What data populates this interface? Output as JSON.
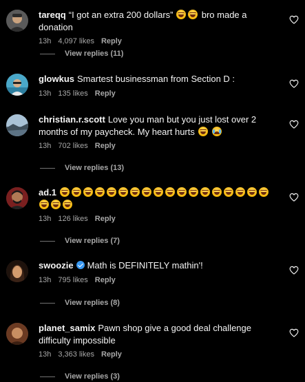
{
  "comments": [
    {
      "username": "tareqq",
      "text": "“I got an extra 200 dollars”",
      "text_after_emoji": "bro made a donation",
      "emojis": [
        "laugh-emoji",
        "laugh-emoji"
      ],
      "time": "13h",
      "likes": "4,097 likes",
      "reply_label": "Reply",
      "view_replies": "View replies (11)",
      "avatar_color": "#6e6e6e"
    },
    {
      "username": "glowkus",
      "text": "Smartest businessman from Section D :",
      "time": "13h",
      "likes": "135 likes",
      "reply_label": "Reply",
      "avatar_color": "#4aa8c9"
    },
    {
      "username": "christian.r.scott",
      "text": "Love you man but you just lost over 2 months of my paycheck. My heart hurts",
      "emojis": [
        "laugh-emoji",
        "crying-laugh-emoji"
      ],
      "time": "13h",
      "likes": "702 likes",
      "reply_label": "Reply",
      "view_replies": "View replies (13)",
      "avatar_color": "#7a8c99"
    },
    {
      "username": "ad.1",
      "emoji_count": 21,
      "time": "13h",
      "likes": "126 likes",
      "reply_label": "Reply",
      "view_replies": "View replies (7)",
      "avatar_color": "#8a2a2a"
    },
    {
      "username": "swoozie",
      "verified": true,
      "text": "Math is DEFINITELY mathin'!",
      "time": "13h",
      "likes": "795 likes",
      "reply_label": "Reply",
      "view_replies": "View replies (8)",
      "avatar_color": "#5a3b2a"
    },
    {
      "username": "planet_samix",
      "text": "Pawn shop give a good deal challenge difficulty impossible",
      "time": "13h",
      "likes": "3,363 likes",
      "reply_label": "Reply",
      "view_replies": "View replies (3)",
      "avatar_color": "#8a4b2e"
    }
  ],
  "colors": {
    "background": "#000000",
    "text": "#f5f5f5",
    "secondary_text": "#a8a8a8",
    "verified_badge": "#3897f0"
  }
}
